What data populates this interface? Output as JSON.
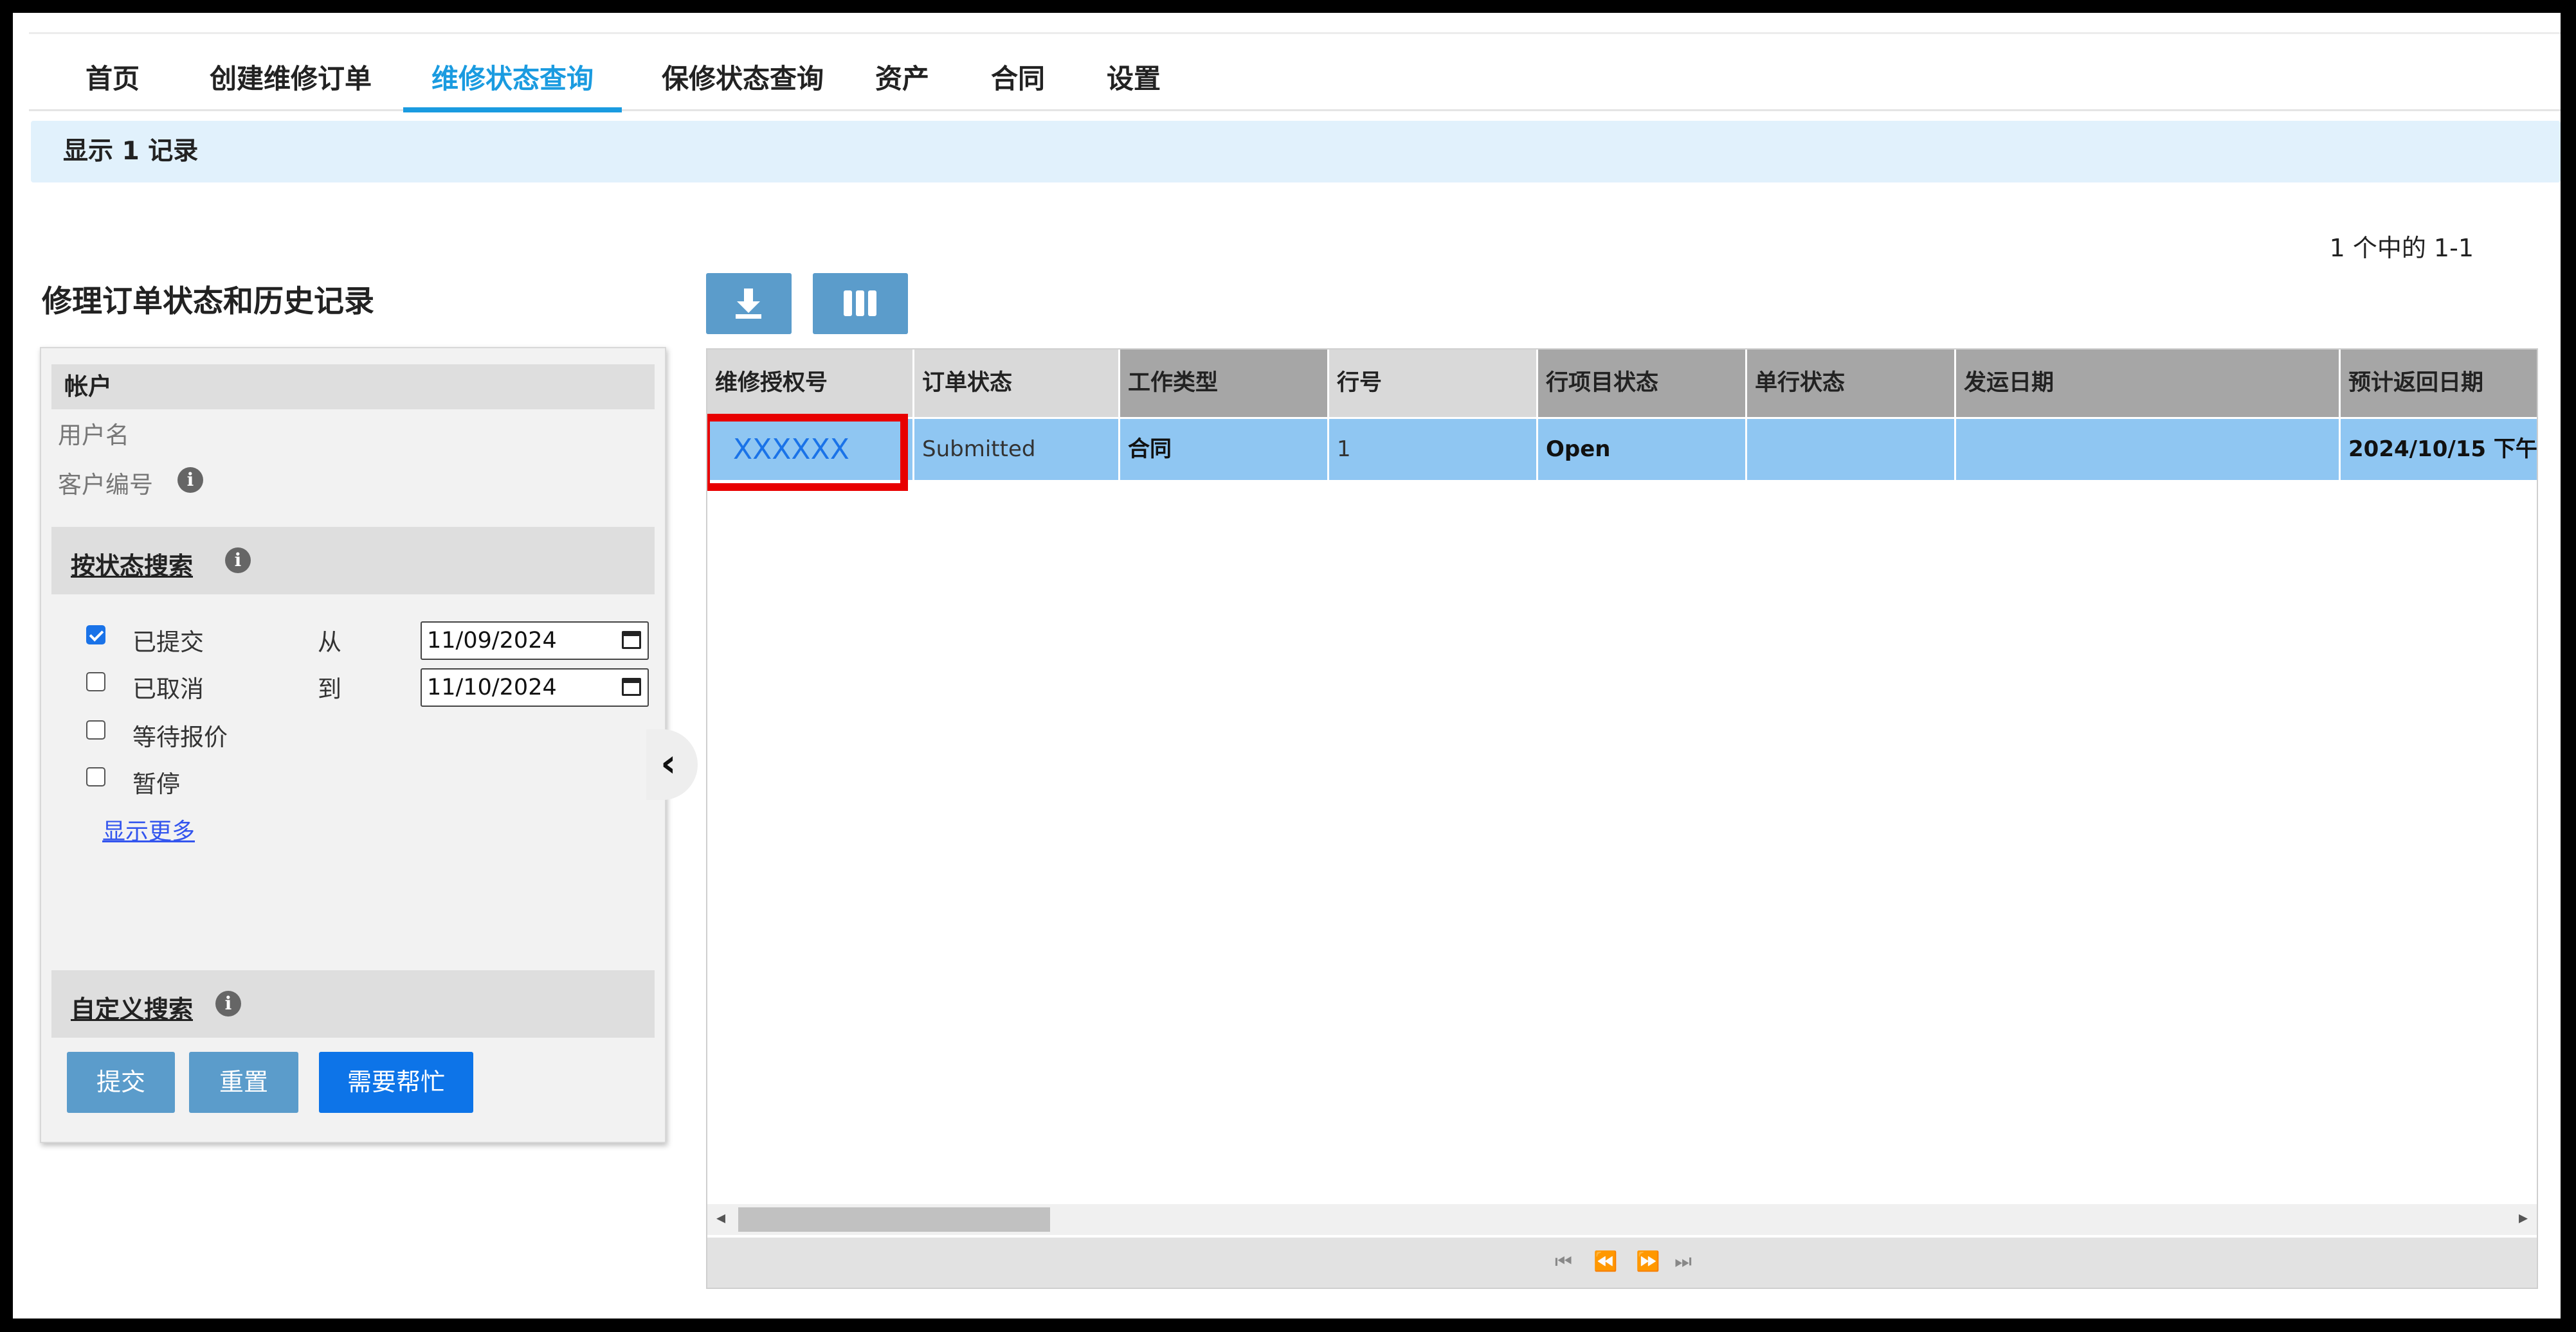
{
  "nav": {
    "tabs": [
      "首页",
      "创建维修订单",
      "维修状态查询",
      "保修状态查询",
      "资产",
      "合同",
      "设置"
    ],
    "active_tab": "维修状态查询"
  },
  "banner": {
    "text": "显示 1 记录"
  },
  "pagination_summary": "1 个中的 1-1",
  "page_title": "修理订单状态和历史记录",
  "filter": {
    "account_header": "帐户",
    "username_label": "用户名",
    "customer_no_label": "客户编号",
    "status_search_label": "按状态搜索",
    "statuses": [
      {
        "label": "已提交",
        "checked": true
      },
      {
        "label": "已取消",
        "checked": false
      },
      {
        "label": "等待报价",
        "checked": false
      },
      {
        "label": "暂停",
        "checked": false
      }
    ],
    "from_label": "从",
    "to_label": "到",
    "from_date": "11/09/2024",
    "to_date": "11/10/2024",
    "show_more": "显示更多",
    "custom_search_label": "自定义搜索",
    "buttons": {
      "submit": "提交",
      "reset": "重置",
      "help": "需要帮忙"
    }
  },
  "table": {
    "columns": [
      "维修授权号",
      "订单状态",
      "工作类型",
      "行号",
      "行项目状态",
      "单行状态",
      "发运日期",
      "预计返回日期"
    ],
    "rows": [
      [
        "XXXXXX",
        "Submitted",
        "合同",
        "1",
        "Open",
        "",
        "",
        "2024/10/15 下午"
      ]
    ]
  },
  "icons": {
    "download": "download-icon",
    "columns": "columns-icon",
    "collapse": "chevron-left-icon",
    "info": "info-icon",
    "calendar": "calendar-icon"
  },
  "colors": {
    "accent": "#1a9be0",
    "selected_row": "#8fc6f2",
    "highlight": "#e80000",
    "primary_button": "#0d74e8",
    "secondary_button": "#5b9ccb"
  }
}
